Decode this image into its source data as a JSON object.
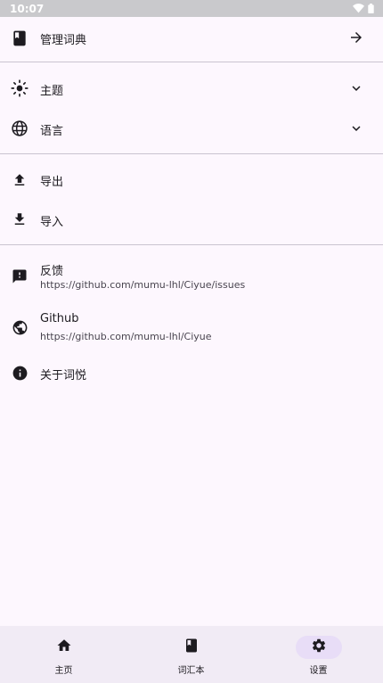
{
  "status_bar": {
    "time": "10:07",
    "icons": [
      "wifi-icon",
      "battery-icon"
    ]
  },
  "settings": {
    "manage_dictionary": {
      "label": "管理词典",
      "icon": "book-icon",
      "trailing_icon": "arrow-right-icon"
    },
    "theme": {
      "label": "主题",
      "icon": "brightness-icon",
      "trailing_icon": "chevron-down-icon"
    },
    "language": {
      "label": "语言",
      "icon": "globe-icon",
      "trailing_icon": "chevron-down-icon"
    },
    "export": {
      "label": "导出",
      "icon": "upload-icon"
    },
    "import": {
      "label": "导入",
      "icon": "download-icon"
    },
    "feedback": {
      "label": "反馈",
      "subtitle": "https://github.com/mumu-lhl/Ciyue/issues",
      "icon": "feedback-icon"
    },
    "github": {
      "label": "Github",
      "subtitle": "https://github.com/mumu-lhl/Ciyue",
      "icon": "public-globe-icon"
    },
    "about": {
      "label": "关于词悦",
      "icon": "info-icon"
    }
  },
  "bottom_nav": {
    "items": [
      {
        "label": "主页",
        "icon": "home-icon",
        "active": false
      },
      {
        "label": "词汇本",
        "icon": "book-icon",
        "active": false
      },
      {
        "label": "设置",
        "icon": "gear-icon",
        "active": true
      }
    ]
  },
  "colors": {
    "background": "#fdf7fe",
    "nav_background": "#f1ebf5",
    "active_pill": "#e8ddf7",
    "divider": "#cac4d0",
    "text": "#1d1b20"
  }
}
